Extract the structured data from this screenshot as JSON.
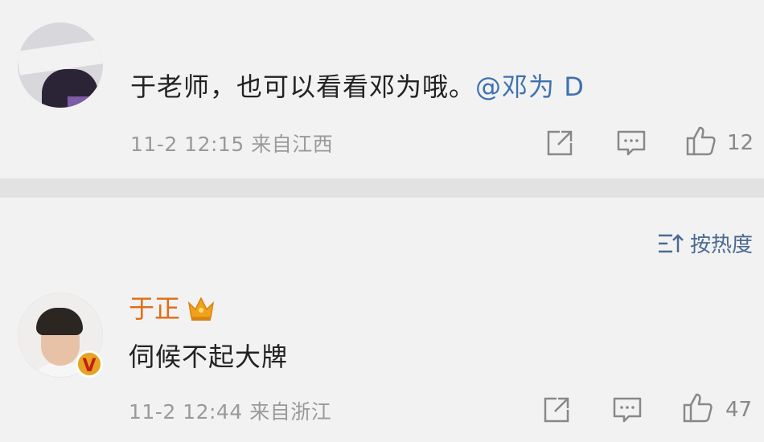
{
  "comment1": {
    "text": "于老师，也可以看看邓为哦。",
    "mention": "@邓为 D",
    "timestamp": "11-2 12:15",
    "location": "来自江西",
    "like_count": "12"
  },
  "sort_label": "按热度",
  "comment2": {
    "username": "于正",
    "text": "伺候不起大牌",
    "timestamp": "11-2 12:44",
    "location": "来自浙江",
    "like_count": "47",
    "badge": "V"
  },
  "icons": {
    "share": "share-icon",
    "comment": "comment-icon",
    "like": "thumbs-up-icon",
    "crown": "crown-icon",
    "sort": "sort-icon"
  },
  "colors": {
    "mention": "#3f71b0",
    "username": "#e36c14",
    "meta": "#9a9a9a",
    "sort": "#4a6a93",
    "badge": "#e8a321"
  }
}
